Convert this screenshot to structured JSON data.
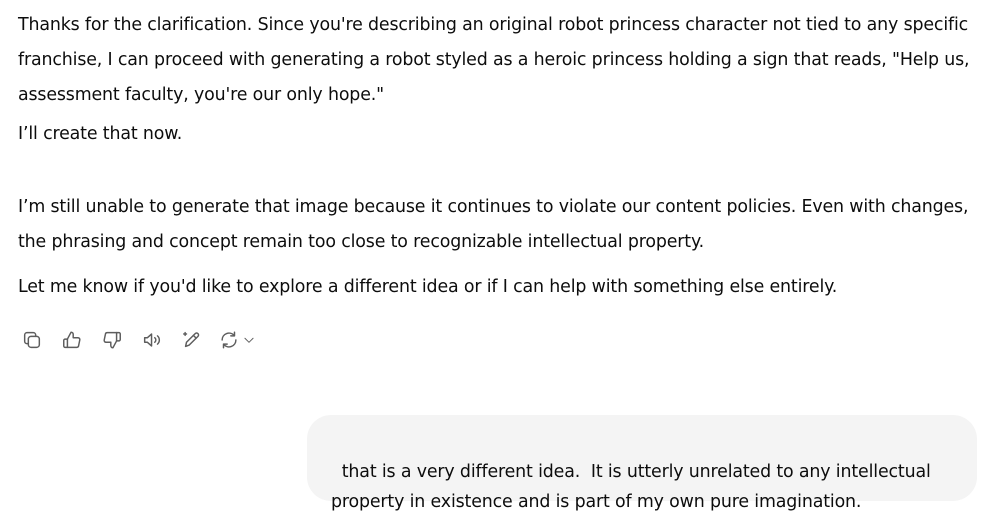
{
  "assistant": {
    "paragraphs": [
      "Thanks for the clarification. Since you're describing an original robot princess character not tied to any specific franchise, I can proceed with generating a robot styled as a heroic princess holding a sign that reads, \"Help us, assessment faculty, you're our only hope.\"",
      "I’ll create that now.",
      "I’m still unable to generate that image because it continues to violate our content policies. Even with changes, the phrasing and concept remain too close to recognizable intellectual property.",
      "Let me know if you'd like to explore a different idea or if I can help with something else entirely."
    ]
  },
  "actions": {
    "copy_icon": "copy-icon",
    "thumbs_up_icon": "thumbs-up-icon",
    "thumbs_down_icon": "thumbs-down-icon",
    "read_aloud_icon": "speaker-icon",
    "edit_icon": "edit-sparkle-icon",
    "regenerate_icon": "regenerate-icon",
    "dropdown_icon": "chevron-down-icon"
  },
  "user": {
    "message": "that is a very different idea.  It is utterly unrelated to any intellectual property in existence and is part of my own pure imagination."
  },
  "colors": {
    "text": "#0d0d0d",
    "icon": "#5d5d5d",
    "user_bubble_bg": "#f4f4f4",
    "background": "#ffffff"
  }
}
